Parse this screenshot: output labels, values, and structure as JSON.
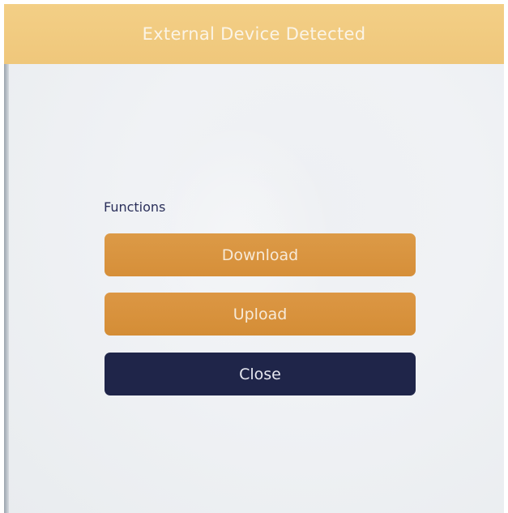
{
  "dialog": {
    "title": "External Device Detected"
  },
  "functions": {
    "label": "Functions",
    "buttons": {
      "download": "Download",
      "upload": "Upload",
      "close": "Close"
    }
  },
  "colors": {
    "title_bar": "#efc77b",
    "primary_button": "#d8923d",
    "close_button": "#1f2549",
    "label_text": "#2a2f5a"
  }
}
